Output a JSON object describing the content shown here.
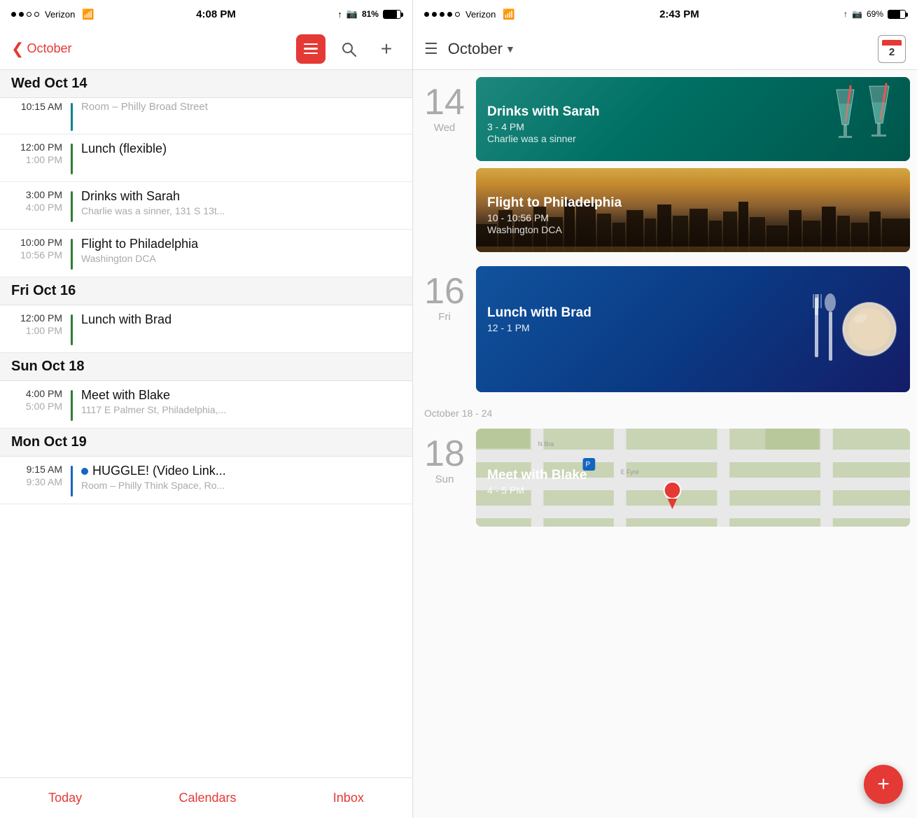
{
  "left": {
    "status": {
      "carrier": "Verizon",
      "time": "4:08 PM",
      "battery": "81%"
    },
    "nav": {
      "back_label": "October",
      "title": "October"
    },
    "days": [
      {
        "header": "Wed  Oct 14",
        "events": [
          {
            "start": "10:15 AM",
            "end": "",
            "title": "Room – Philly Broad Street",
            "subtitle": "",
            "bar_color": "teal",
            "dot": false
          },
          {
            "start": "12:00 PM",
            "end": "1:00 PM",
            "title": "Lunch (flexible)",
            "subtitle": "",
            "bar_color": "green",
            "dot": false
          },
          {
            "start": "3:00 PM",
            "end": "4:00 PM",
            "title": "Drinks with Sarah",
            "subtitle": "Charlie was a sinner, 131 S 13t...",
            "bar_color": "green",
            "dot": false
          },
          {
            "start": "10:00 PM",
            "end": "10:56 PM",
            "title": "Flight to Philadelphia",
            "subtitle": "Washington DCA",
            "bar_color": "green",
            "dot": false
          }
        ]
      },
      {
        "header": "Fri  Oct 16",
        "events": [
          {
            "start": "12:00 PM",
            "end": "1:00 PM",
            "title": "Lunch with Brad",
            "subtitle": "",
            "bar_color": "green",
            "dot": false
          }
        ]
      },
      {
        "header": "Sun  Oct 18",
        "events": [
          {
            "start": "4:00 PM",
            "end": "5:00 PM",
            "title": "Meet with Blake",
            "subtitle": "1117 E Palmer St, Philadelphia,...",
            "bar_color": "green",
            "dot": false
          }
        ]
      },
      {
        "header": "Mon  Oct 19",
        "events": [
          {
            "start": "9:15 AM",
            "end": "9:30 AM",
            "title": "HUGGLE! (Video Link...",
            "subtitle": "Room – Philly Think Space, Ro...",
            "bar_color": "blue",
            "dot": true
          }
        ]
      }
    ],
    "tabs": [
      {
        "label": "Today"
      },
      {
        "label": "Calendars"
      },
      {
        "label": "Inbox"
      }
    ]
  },
  "right": {
    "status": {
      "carrier": "Verizon",
      "time": "2:43 PM",
      "battery": "69%"
    },
    "nav": {
      "title": "October",
      "calendar_num": "2"
    },
    "section1": {
      "date_num": "14",
      "date_day": "Wed",
      "events": [
        {
          "title": "Drinks with Sarah",
          "time": "3 - 4 PM",
          "location": "Charlie was a sinner",
          "type": "drinks"
        },
        {
          "title": "Flight to Philadelphia",
          "time": "10 - 10:56 PM",
          "location": "Washington DCA",
          "type": "flight"
        }
      ]
    },
    "section2": {
      "date_num": "16",
      "date_day": "Fri",
      "events": [
        {
          "title": "Lunch with Brad",
          "time": "12 - 1 PM",
          "location": "",
          "type": "lunch"
        }
      ]
    },
    "week_label": "October 18 - 24",
    "section3": {
      "date_num": "18",
      "date_day": "Sun",
      "events": [
        {
          "title": "Meet with Blake",
          "time": "4 - 5 PM",
          "location": "",
          "type": "map"
        }
      ]
    },
    "fab_label": "+"
  }
}
